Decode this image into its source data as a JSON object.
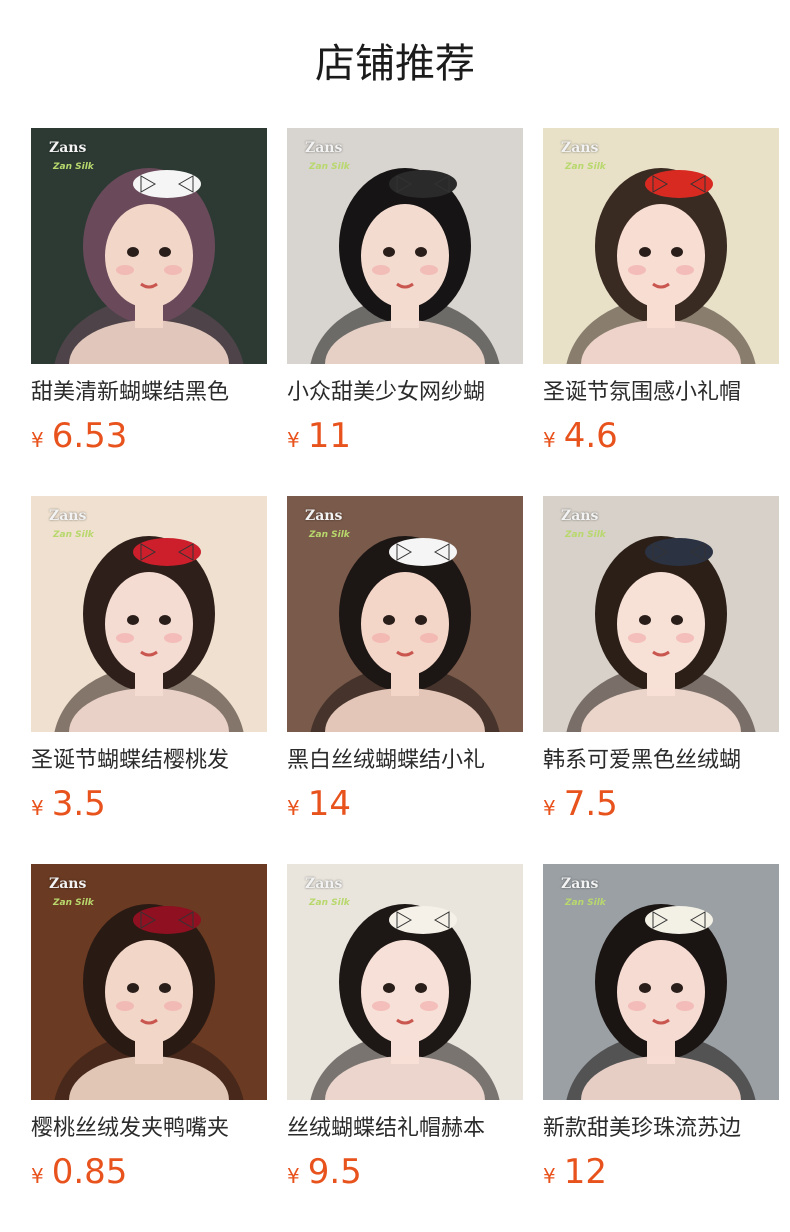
{
  "header": {
    "title": "店铺推荐"
  },
  "watermark": {
    "brand": "Zans",
    "sub": "Zan Silk"
  },
  "products": [
    {
      "name": "甜美清新蝴蝶结黑色",
      "currency": "¥",
      "price": "6.53",
      "bg": "#2c3a33",
      "skin": "#f2d6c8",
      "hair": "#6a4a5a",
      "accent": "#f5f5f5"
    },
    {
      "name": "小众甜美少女网纱蝴",
      "currency": "¥",
      "price": "11",
      "bg": "#d8d4cf",
      "skin": "#f3dbd0",
      "hair": "#161414",
      "accent": "#2a2a2a"
    },
    {
      "name": "圣诞节氛围感小礼帽",
      "currency": "¥",
      "price": "4.6",
      "bg": "#e8e1c8",
      "skin": "#f8ddd3",
      "hair": "#3a2b22",
      "accent": "#d92a22"
    },
    {
      "name": "圣诞节蝴蝶结樱桃发",
      "currency": "¥",
      "price": "3.5",
      "bg": "#efe0cf",
      "skin": "#f5dcd3",
      "hair": "#2e1f1a",
      "accent": "#cc1f2b"
    },
    {
      "name": "黑白丝绒蝴蝶结小礼",
      "currency": "¥",
      "price": "14",
      "bg": "#7a5a4a",
      "skin": "#f4d6c8",
      "hair": "#1c1614",
      "accent": "#f5f5f5"
    },
    {
      "name": "韩系可爱黑色丝绒蝴",
      "currency": "¥",
      "price": "7.5",
      "bg": "#d7d1c9",
      "skin": "#f7e0d6",
      "hair": "#2b1f18",
      "accent": "#2b3242"
    },
    {
      "name": "樱桃丝绒发夹鸭嘴夹",
      "currency": "¥",
      "price": "0.85",
      "bg": "#6a3a22",
      "skin": "#f2d7c8",
      "hair": "#2a1a14",
      "accent": "#8f1020"
    },
    {
      "name": "丝绒蝴蝶结礼帽赫本",
      "currency": "¥",
      "price": "9.5",
      "bg": "#e9e5dd",
      "skin": "#f7e0d7",
      "hair": "#1d1715",
      "accent": "#f6f1e8"
    },
    {
      "name": "新款甜美珍珠流苏边",
      "currency": "¥",
      "price": "12",
      "bg": "#9aa0a4",
      "skin": "#f6dbd2",
      "hair": "#1a1413",
      "accent": "#f3f0e6"
    }
  ]
}
